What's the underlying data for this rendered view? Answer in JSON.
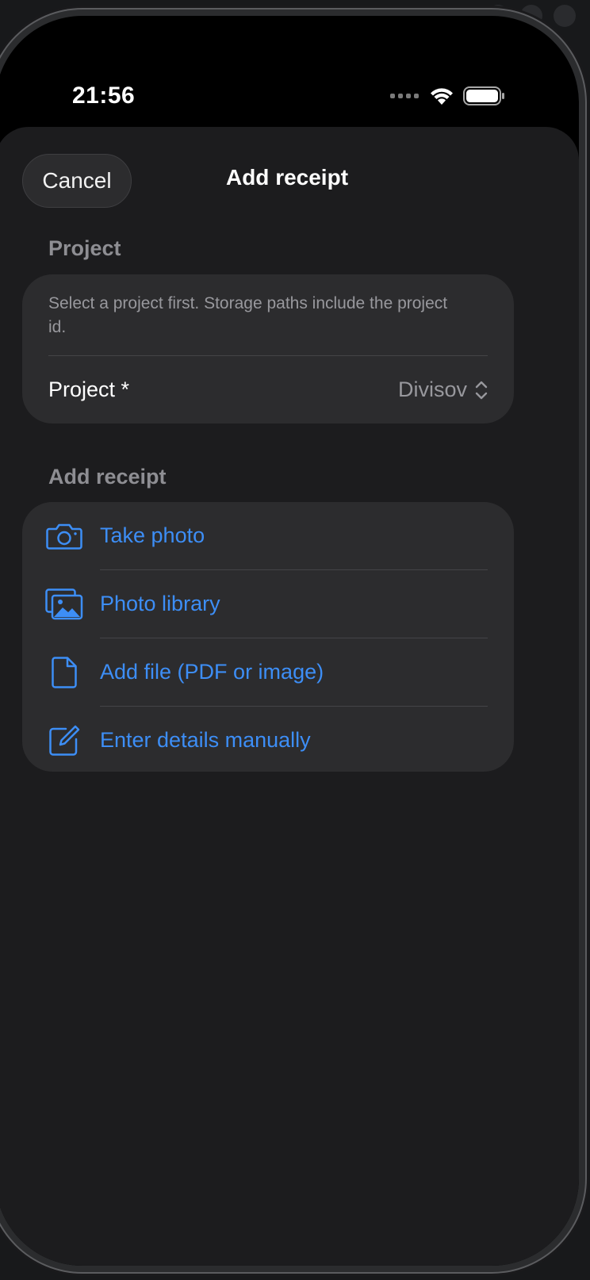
{
  "status_bar": {
    "time": "21:56"
  },
  "sheet": {
    "cancel_label": "Cancel",
    "title": "Add receipt"
  },
  "project_section": {
    "header": "Project",
    "note": "Select a project first. Storage paths include the project id.",
    "field_label": "Project *",
    "field_value": "Divisov"
  },
  "add_section": {
    "header": "Add receipt",
    "actions": [
      {
        "label": "Take photo",
        "icon": "camera-icon"
      },
      {
        "label": "Photo library",
        "icon": "photo-library-icon"
      },
      {
        "label": "Add file (PDF or image)",
        "icon": "document-icon"
      },
      {
        "label": "Enter details manually",
        "icon": "edit-icon"
      }
    ]
  },
  "colors": {
    "accent": "#3d8ef6",
    "sheet_bg": "#1c1c1e",
    "card_bg": "#2c2c2e",
    "secondary_text": "#8e8e93"
  }
}
